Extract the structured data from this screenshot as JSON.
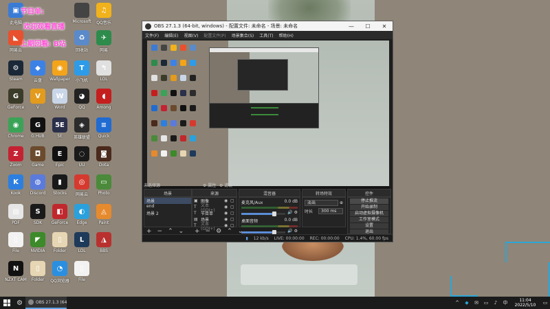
{
  "desktop": {
    "promos": [
      {
        "text": "节目单:"
      },
      {
        "text": "欢迎观看直播"
      },
      {
        "text": "上期回看:"
      },
      {
        "text": "B站"
      }
    ],
    "icons": [
      {
        "label": "此电脑",
        "glyph": "▣",
        "color": "#3a7bd5"
      },
      {
        "label": "Microsoft",
        "glyph": "",
        "color": "#444"
      },
      {
        "label": "QQ音乐",
        "glyph": "♫",
        "color": "#f2b21b"
      },
      {
        "label": "网易云",
        "glyph": "◣",
        "color": "#e9502e"
      },
      {
        "label": "回收站",
        "glyph": "♻",
        "color": "#5a8ac9"
      },
      {
        "label": "网易",
        "glyph": "✈",
        "color": "#2d8b4c"
      },
      {
        "label": "Steam",
        "glyph": "⚙",
        "color": "#1b2838"
      },
      {
        "label": "云盘",
        "glyph": "◆",
        "color": "#3c82e6"
      },
      {
        "label": "Wallpaper",
        "glyph": "◉",
        "color": "#f3a41a"
      },
      {
        "label": "小飞机",
        "glyph": "T",
        "color": "#2d9be8"
      },
      {
        "label": "LOL",
        "glyph": "↰",
        "color": "#e0e0e0"
      },
      {
        "label": "GeForce",
        "glyph": "G",
        "color": "#3b3b2a"
      },
      {
        "label": "V",
        "glyph": "V",
        "color": "#e39b1d"
      },
      {
        "label": "Word",
        "glyph": "W",
        "color": "#c9d6e8"
      },
      {
        "label": "QQ",
        "glyph": "◕",
        "color": "#222"
      },
      {
        "label": "Among",
        "glyph": "◖",
        "color": "#c51e1e"
      },
      {
        "label": "Chrome",
        "glyph": "◉",
        "color": "#3aa357"
      },
      {
        "label": "G HUB",
        "glyph": "G",
        "color": "#111"
      },
      {
        "label": "5E",
        "glyph": "5E",
        "color": "#2a2f4a"
      },
      {
        "label": "英雄联盟",
        "glyph": "◈",
        "color": "#2c2c2c"
      },
      {
        "label": "Quick",
        "glyph": "≡",
        "color": "#1f6bd1"
      },
      {
        "label": "Zoom",
        "glyph": "Z",
        "color": "#c42232"
      },
      {
        "label": "Game",
        "glyph": "◘",
        "color": "#6b4a2e"
      },
      {
        "label": "Epic",
        "glyph": "E",
        "color": "#111"
      },
      {
        "label": "UU",
        "glyph": "◌",
        "color": "#1a1a1a"
      },
      {
        "label": "Dota",
        "glyph": "◙",
        "color": "#4a2a1c"
      },
      {
        "label": "Kook",
        "glyph": "K",
        "color": "#2c7fe0"
      },
      {
        "label": "Discord",
        "glyph": "◍",
        "color": "#5b7bdc"
      },
      {
        "label": "Stocks",
        "glyph": "▮",
        "color": "#1a1a1a"
      },
      {
        "label": "网易云",
        "glyph": "◎",
        "color": "#d63a2f"
      },
      {
        "label": "Photo",
        "glyph": "▭",
        "color": "#4a8a3a"
      },
      {
        "label": "PDF",
        "glyph": "▤",
        "color": "#e6e6e6"
      },
      {
        "label": "SDK",
        "glyph": "S",
        "color": "#1a1a1a"
      },
      {
        "label": "GeForce",
        "glyph": "◧",
        "color": "#c0282d"
      },
      {
        "label": "Edge",
        "glyph": "◐",
        "color": "#2aa1dd"
      },
      {
        "label": "Paint",
        "glyph": "◬",
        "color": "#e68a2e"
      },
      {
        "label": "File",
        "glyph": "▯",
        "color": "#f2f2f2"
      },
      {
        "label": "NVIDIA",
        "glyph": "◤",
        "color": "#3c8a2a"
      },
      {
        "label": "Folder",
        "glyph": "▯",
        "color": "#e6d6b3"
      },
      {
        "label": "LOL",
        "glyph": "L",
        "color": "#1e3a5a"
      },
      {
        "label": "BBS",
        "glyph": "◮",
        "color": "#b8312f"
      },
      {
        "label": "NZXT CAM",
        "glyph": "N",
        "color": "#111"
      },
      {
        "label": "Folder",
        "glyph": "▯",
        "color": "#e6d6b3"
      },
      {
        "label": "QQ浏览器",
        "glyph": "◔",
        "color": "#2a8fe0"
      },
      {
        "label": "File",
        "glyph": "▯",
        "color": "#f2f2f2"
      }
    ]
  },
  "obs": {
    "title": "OBS 27.1.3 (64-bit, windows) - 配置文件: 未命名 - 场景: 未命名",
    "window_controls": [
      "—",
      "☐",
      "✕"
    ],
    "menu": [
      "文件(F)",
      "编辑(E)",
      "视图(V)",
      "配置文件(P)",
      "场景集合(S)",
      "工具(T)",
      "帮助(H)"
    ],
    "no_source": "未选择源",
    "props_label": "⚙ 属性",
    "filters_label": "⚙ 滤镜",
    "docks": {
      "scenes_title": "场景",
      "sources_title": "来源",
      "mixer_title": "混音器",
      "transitions_title": "转场特效",
      "controls_title": "控件"
    },
    "scenes": [
      "场景",
      "end",
      "场景 2"
    ],
    "sources": [
      {
        "name": "图像",
        "icon": "▣",
        "dim": false
      },
      {
        "name": "文本 (GDI+)",
        "icon": "T",
        "dim": true
      },
      {
        "name": "节目单",
        "icon": "T",
        "dim": false
      },
      {
        "name": "场景",
        "icon": "▤",
        "dim": false
      },
      {
        "name": "文本 (GDI+)",
        "icon": "T",
        "dim": true
      },
      {
        "name": "start",
        "icon": "▣",
        "dim": true
      }
    ],
    "mixer": [
      {
        "name": "麦克风/Aux",
        "db": "0.0 dB",
        "level": 0.75
      },
      {
        "name": "桌面音频",
        "db": "0.0 dB",
        "level": 0.75
      }
    ],
    "transition": {
      "type": "淡出",
      "duration_label": "时长",
      "duration": "300 ms"
    },
    "controls": [
      "停止推流",
      "开始录制",
      "启动虚拟摄像机",
      "工作室模式",
      "设置",
      "退出"
    ],
    "status": {
      "live": "LIVE: 00:00:00",
      "rec": "REC: 00:00:00",
      "cpu": "CPU: 1.4%, 60.00 fps",
      "bitrate": "12 kb/s"
    }
  },
  "taskbar": {
    "obs_label": "OBS 27.1.3 (64-bi...",
    "time": "11:04",
    "date": "2022/5/10",
    "tray": [
      "^",
      "◆",
      "✉",
      "▭",
      "♪",
      "中"
    ]
  }
}
